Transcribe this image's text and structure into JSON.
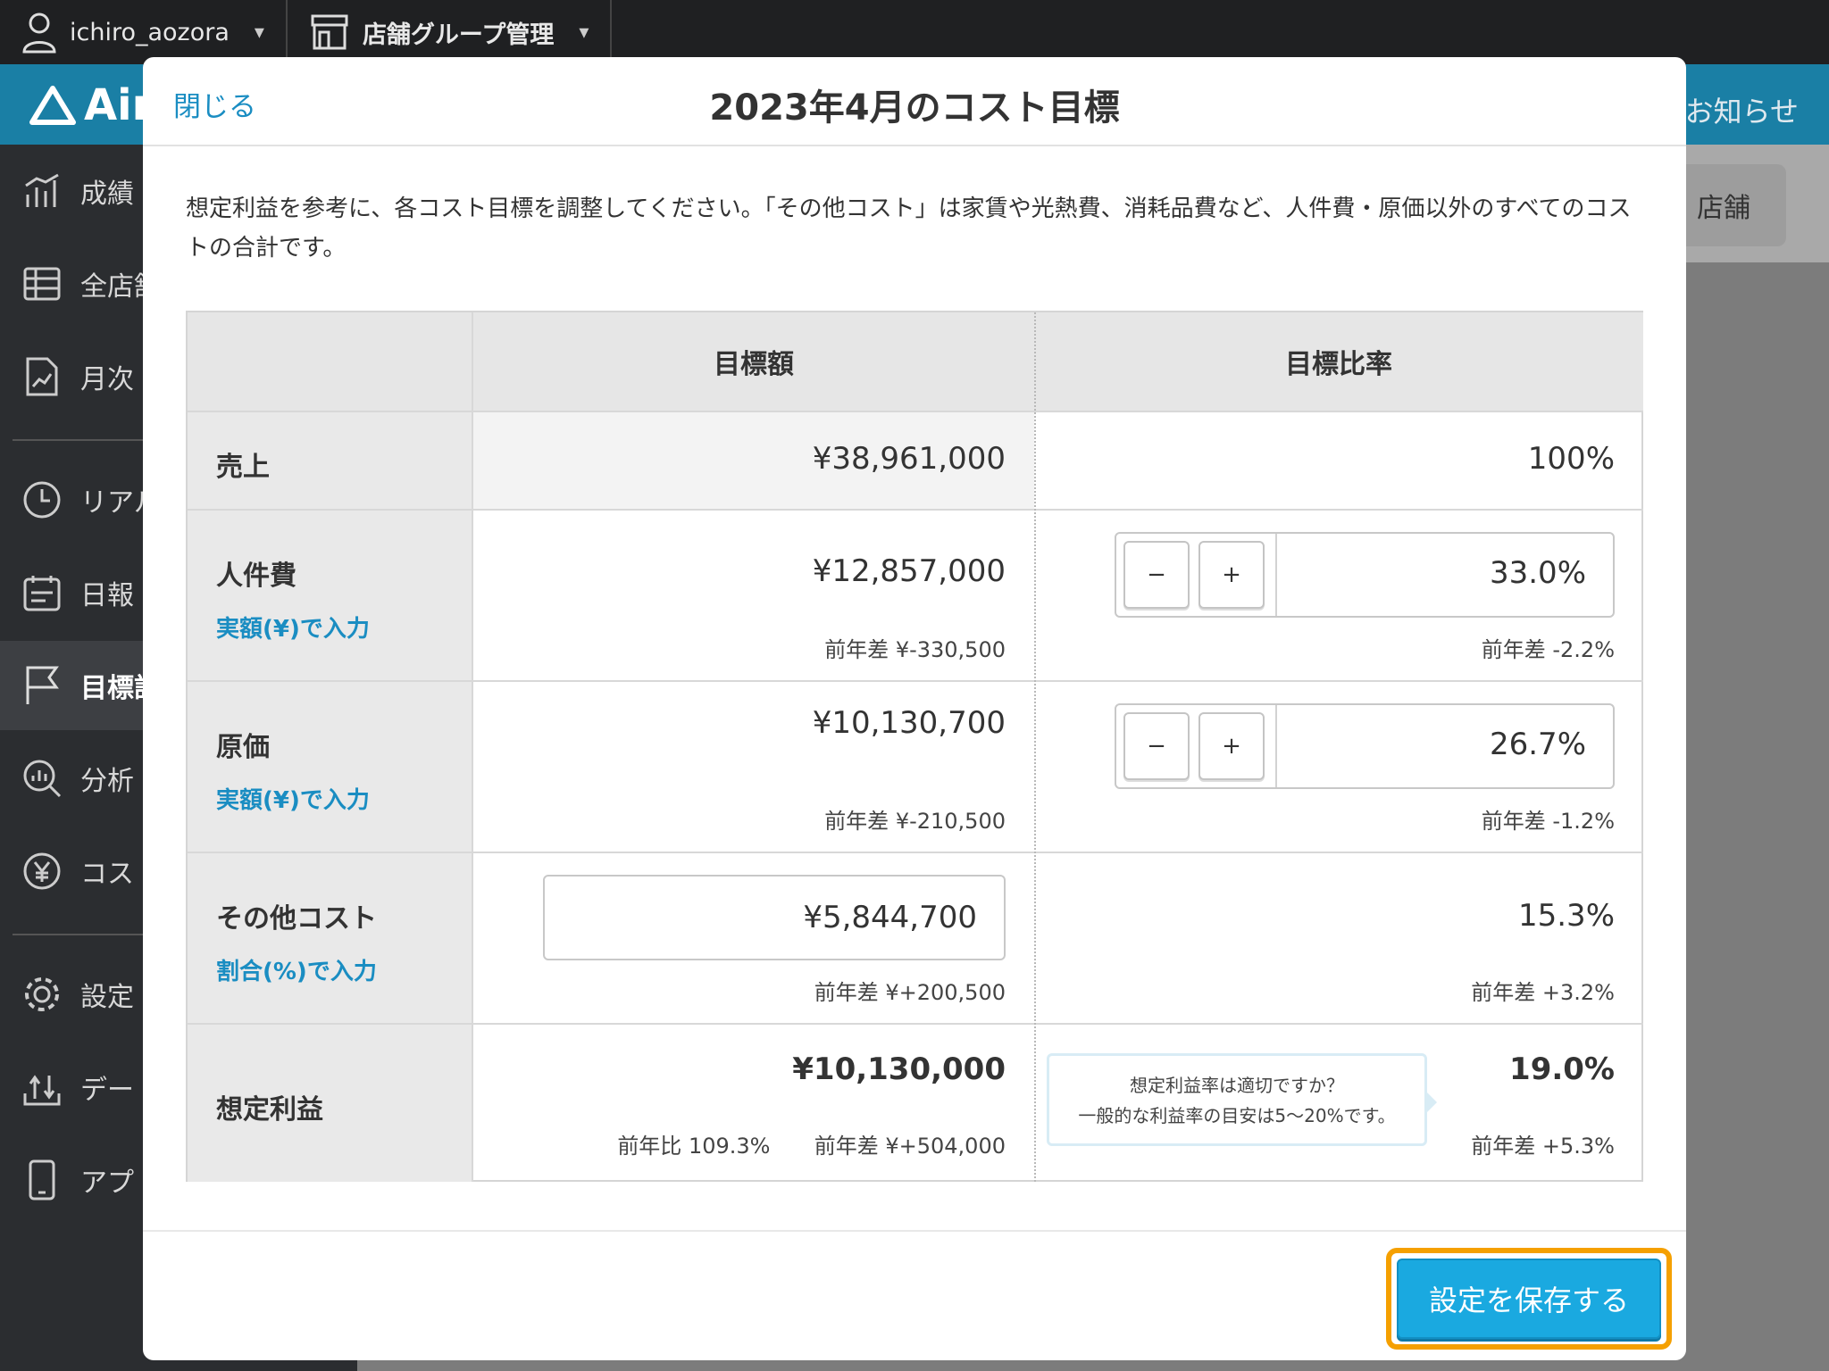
{
  "topbar": {
    "username": "ichiro_aozora",
    "store_group": "店舗グループ管理"
  },
  "header": {
    "brand": "Air",
    "notice": "お知らせ",
    "store_button": "店舗"
  },
  "sidebar": {
    "items": [
      {
        "label": "成績",
        "icon": "chart-icon"
      },
      {
        "label": "全店舗",
        "icon": "table-icon"
      },
      {
        "label": "月次",
        "icon": "doc-chart-icon"
      },
      {
        "label": "リアル",
        "icon": "clock-icon"
      },
      {
        "label": "日報",
        "icon": "calendar-icon"
      },
      {
        "label": "目標設",
        "icon": "flag-icon"
      },
      {
        "label": "分析",
        "icon": "magnifier-icon"
      },
      {
        "label": "コス",
        "icon": "yen-icon"
      },
      {
        "label": "設定",
        "icon": "gear-icon"
      },
      {
        "label": "デー",
        "icon": "upload-icon"
      },
      {
        "label": "アプ",
        "icon": "phone-icon"
      }
    ]
  },
  "modal": {
    "close": "閉じる",
    "title": "2023年4月のコスト目標",
    "description": "想定利益を参考に、各コスト目標を調整してください。「その他コスト」は家賃や光熱費、消耗品費など、人件費・原価以外のすべてのコストの合計です。",
    "table": {
      "col_amount": "目標額",
      "col_ratio": "目標比率",
      "rows": {
        "sales": {
          "label": "売上",
          "amount": "¥38,961,000",
          "ratio": "100%"
        },
        "labor": {
          "label": "人件費",
          "link": "実額(¥)で入力",
          "amount": "¥12,857,000",
          "amount_diff": "前年差 ¥-330,500",
          "ratio": "33.0%",
          "ratio_diff": "前年差 -2.2%",
          "minus": "−",
          "plus": "+"
        },
        "cogs": {
          "label": "原価",
          "link": "実額(¥)で入力",
          "amount": "¥10,130,700",
          "amount_diff": "前年差 ¥-210,500",
          "ratio": "26.7%",
          "ratio_diff": "前年差 -1.2%",
          "minus": "−",
          "plus": "+"
        },
        "other": {
          "label": "その他コスト",
          "link": "割合(%)で入力",
          "amount": "¥5,844,700",
          "amount_diff": "前年差 ¥+200,500",
          "ratio": "15.3%",
          "ratio_diff": "前年差 +3.2%"
        },
        "profit": {
          "label": "想定利益",
          "amount": "¥10,130,000",
          "yoy": "前年比 109.3%",
          "amount_diff": "前年差 ¥+504,000",
          "ratio": "19.0%",
          "ratio_diff": "前年差 +5.3%",
          "tooltip_line1": "想定利益率は適切ですか？",
          "tooltip_line2": "一般的な利益率の目安は5〜20%です。"
        }
      }
    },
    "save": "設定を保存する"
  }
}
